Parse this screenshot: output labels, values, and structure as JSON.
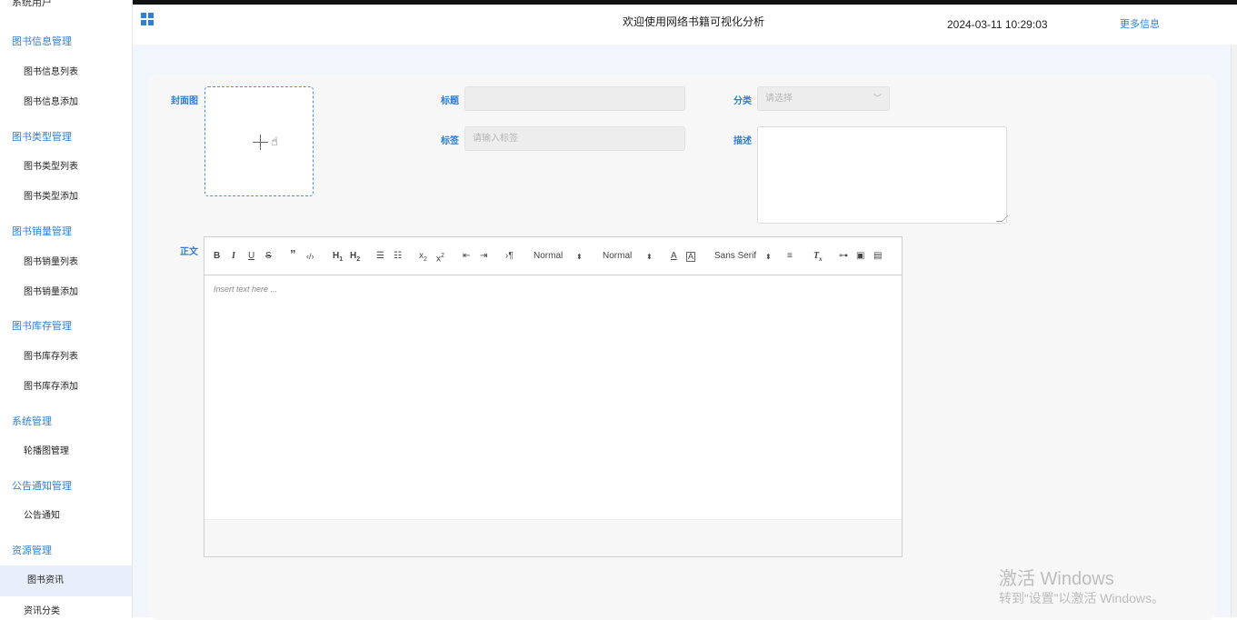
{
  "sidebar": {
    "cut_item": "系统用户",
    "groups": [
      {
        "label": "图书信息管理",
        "items": [
          "图书信息列表",
          "图书信息添加"
        ]
      },
      {
        "label": "图书类型管理",
        "items": [
          "图书类型列表",
          "图书类型添加"
        ]
      },
      {
        "label": "图书销量管理",
        "items": [
          "图书销量列表",
          "图书销量添加"
        ]
      },
      {
        "label": "图书库存管理",
        "items": [
          "图书库存列表",
          "图书库存添加"
        ]
      },
      {
        "label": "系统管理",
        "items": [
          "轮播图管理"
        ]
      },
      {
        "label": "公告通知管理",
        "items": [
          "公告通知"
        ]
      },
      {
        "label": "资源管理",
        "items": [
          "图书资讯",
          "资讯分类"
        ]
      }
    ],
    "active_item": "图书资讯"
  },
  "header": {
    "title": "欢迎使用网络书籍可视化分析",
    "datetime": "2024-03-11 10:29:03",
    "more": "更多信息"
  },
  "form": {
    "cover_label": "封面图",
    "title_label": "标题",
    "title_value": "",
    "category_label": "分类",
    "category_placeholder": "请选择",
    "tags_label": "标签",
    "tags_placeholder": "请输入标签",
    "desc_label": "描述",
    "body_label": "正文"
  },
  "editor": {
    "toolbar": {
      "header_select": "Normal",
      "size_select": "Normal",
      "font_select": "Sans Serif"
    },
    "placeholder": "Insert text here ..."
  },
  "watermark": {
    "line1": "激活 Windows",
    "line2": "转到“设置”以激活 Windows。"
  },
  "colors": {
    "accent": "#2e7fd6",
    "main_bg": "#f1f6fc",
    "active_bg": "#e8effb"
  }
}
